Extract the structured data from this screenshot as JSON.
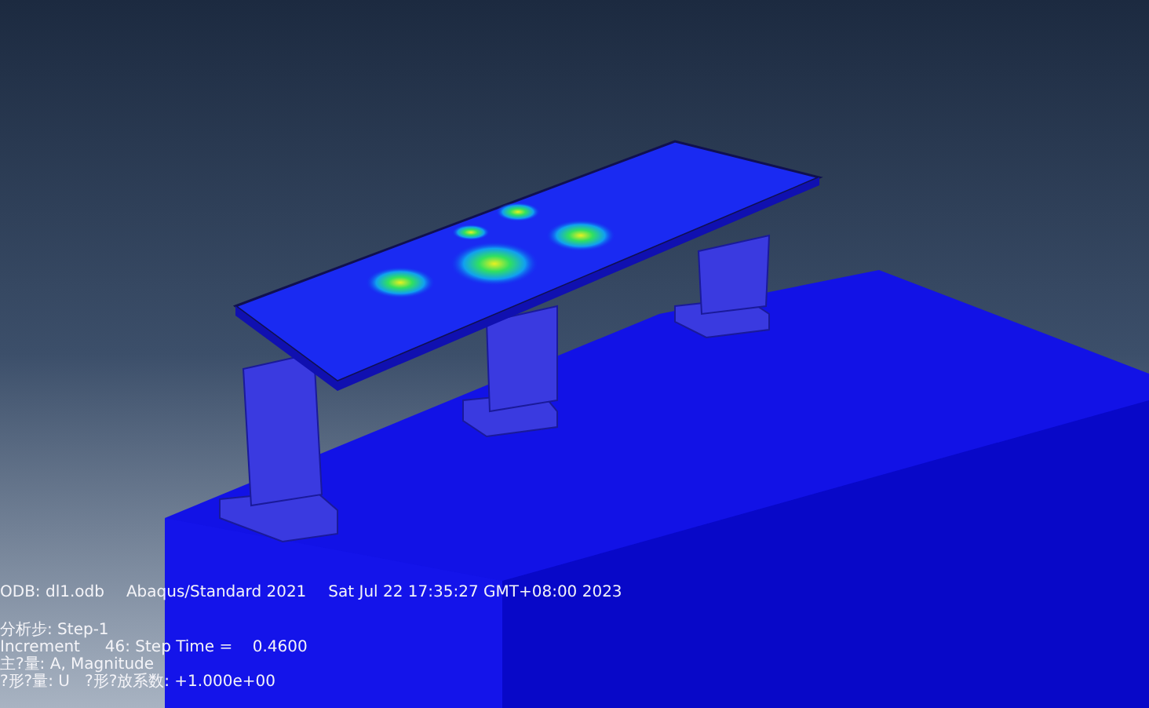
{
  "viewport": {
    "header": [
      "ODB: dl1.odb",
      "Abaqus/Standard 2021",
      "Sat Jul 22 17:35:27 GMT+08:00 2023"
    ],
    "lines": [
      "分析步: Step-1",
      "Increment     46: Step Time =    0.4600",
      "主?量: A, Magnitude",
      "?形?量: U   ?形?放系数: +1.000e+00"
    ]
  }
}
